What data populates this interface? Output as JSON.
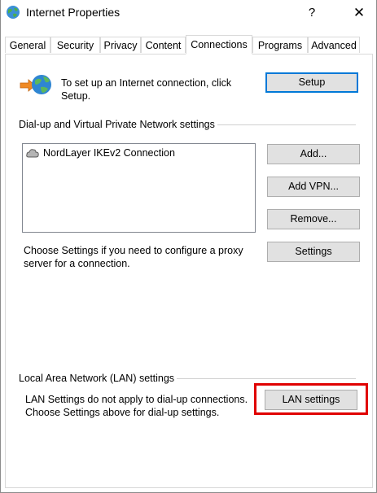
{
  "window": {
    "title": "Internet Properties",
    "help_label": "?",
    "close_label": "✕"
  },
  "tabs": [
    {
      "label": "General",
      "active": false
    },
    {
      "label": "Security",
      "active": false
    },
    {
      "label": "Privacy",
      "active": false
    },
    {
      "label": "Content",
      "active": false
    },
    {
      "label": "Connections",
      "active": true
    },
    {
      "label": "Programs",
      "active": false
    },
    {
      "label": "Advanced",
      "active": false
    }
  ],
  "setup": {
    "description": "To set up an Internet connection, click Setup.",
    "button_label": "Setup"
  },
  "dialup": {
    "group_label": "Dial-up and Virtual Private Network settings",
    "connections": [
      {
        "name": "NordLayer IKEv2 Connection"
      }
    ],
    "add_label": "Add...",
    "add_vpn_label": "Add VPN...",
    "remove_label": "Remove...",
    "proxy_text": "Choose Settings if you need to configure a proxy server for a connection.",
    "settings_label": "Settings"
  },
  "lan": {
    "group_label": "Local Area Network (LAN) settings",
    "description": "LAN Settings do not apply to dial-up connections. Choose Settings above for dial-up settings.",
    "button_label": "LAN settings"
  },
  "colors": {
    "highlight": "#e00000",
    "default_button_border": "#0078d7",
    "button_face": "#e1e1e1"
  },
  "icons": {
    "title": "globe-icon",
    "setup": "internet-connection-icon",
    "connection": "vpn-connection-icon"
  }
}
